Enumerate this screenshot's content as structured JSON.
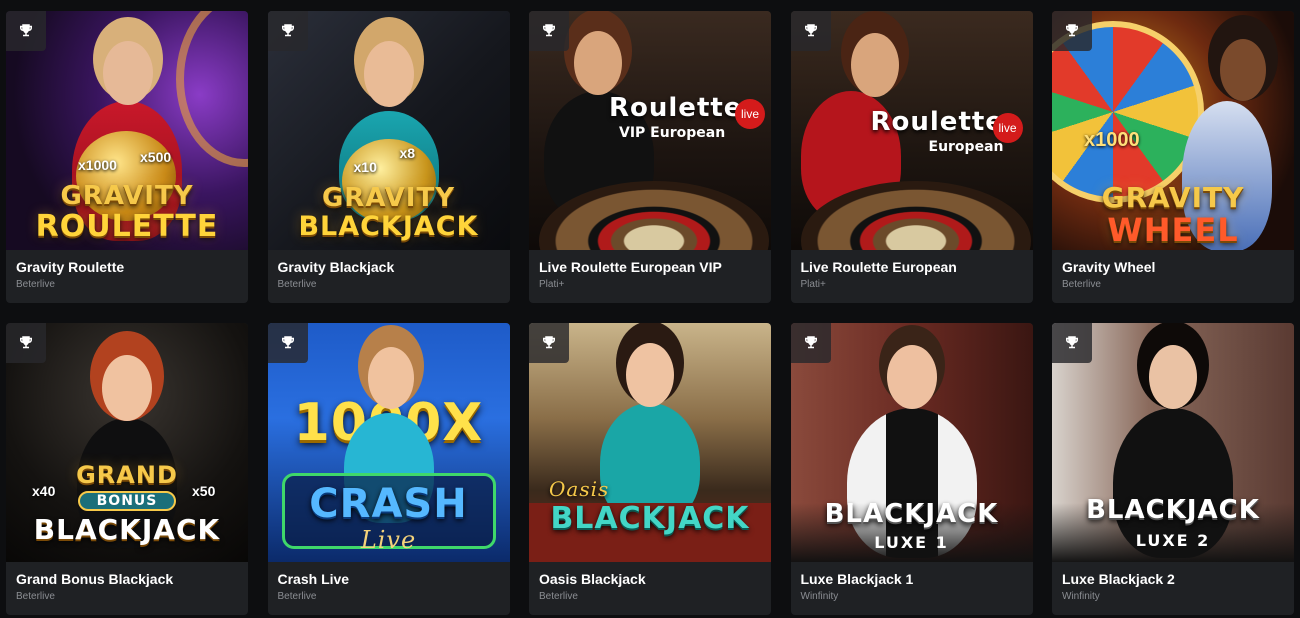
{
  "games": [
    {
      "title": "Gravity Roulette",
      "provider": "Beterlive",
      "art": {
        "line1": "GRAVITY",
        "line2": "ROULETTE",
        "mult_a": "x1000",
        "mult_b": "x500"
      }
    },
    {
      "title": "Gravity Blackjack",
      "provider": "Beterlive",
      "art": {
        "line1": "GRAVITY",
        "line2": "BLACKJACK",
        "mult_a": "x10",
        "mult_b": "x8"
      }
    },
    {
      "title": "Live Roulette European VIP",
      "provider": "Plati+",
      "art": {
        "line1": "Roulette",
        "line2": "VIP European",
        "badge": "live"
      }
    },
    {
      "title": "Live Roulette European",
      "provider": "Plati+",
      "art": {
        "line1": "Roulette",
        "line2": "European",
        "badge": "live"
      }
    },
    {
      "title": "Gravity Wheel",
      "provider": "Beterlive",
      "art": {
        "line1": "GRAVITY",
        "line2": "WHEEL",
        "mult_a": "x1000"
      }
    },
    {
      "title": "Grand Bonus Blackjack",
      "provider": "Beterlive",
      "art": {
        "line1": "GRAND",
        "line_mid": "BONUS",
        "line2": "BLACKJACK",
        "mult_a": "x40",
        "mult_b": "x50"
      }
    },
    {
      "title": "Crash Live",
      "provider": "Beterlive",
      "art": {
        "line0": "1000X",
        "line1": "CRASH",
        "line2": "Live"
      }
    },
    {
      "title": "Oasis Blackjack",
      "provider": "Beterlive",
      "art": {
        "line1": "Oasis",
        "line2": "BLACKJACK"
      }
    },
    {
      "title": "Luxe Blackjack 1",
      "provider": "Winfinity",
      "art": {
        "line1": "BLACKJACK",
        "line2": "LUXE 1"
      }
    },
    {
      "title": "Luxe Blackjack 2",
      "provider": "Winfinity",
      "art": {
        "line1": "BLACKJACK",
        "line2": "LUXE 2"
      }
    }
  ],
  "icons": {
    "badge": "trophy-icon"
  },
  "colors": {
    "background": "#0d0e10",
    "card": "#1f2124",
    "title": "#ffffff",
    "provider": "#8b8e93",
    "gold": "#f6c94a"
  }
}
